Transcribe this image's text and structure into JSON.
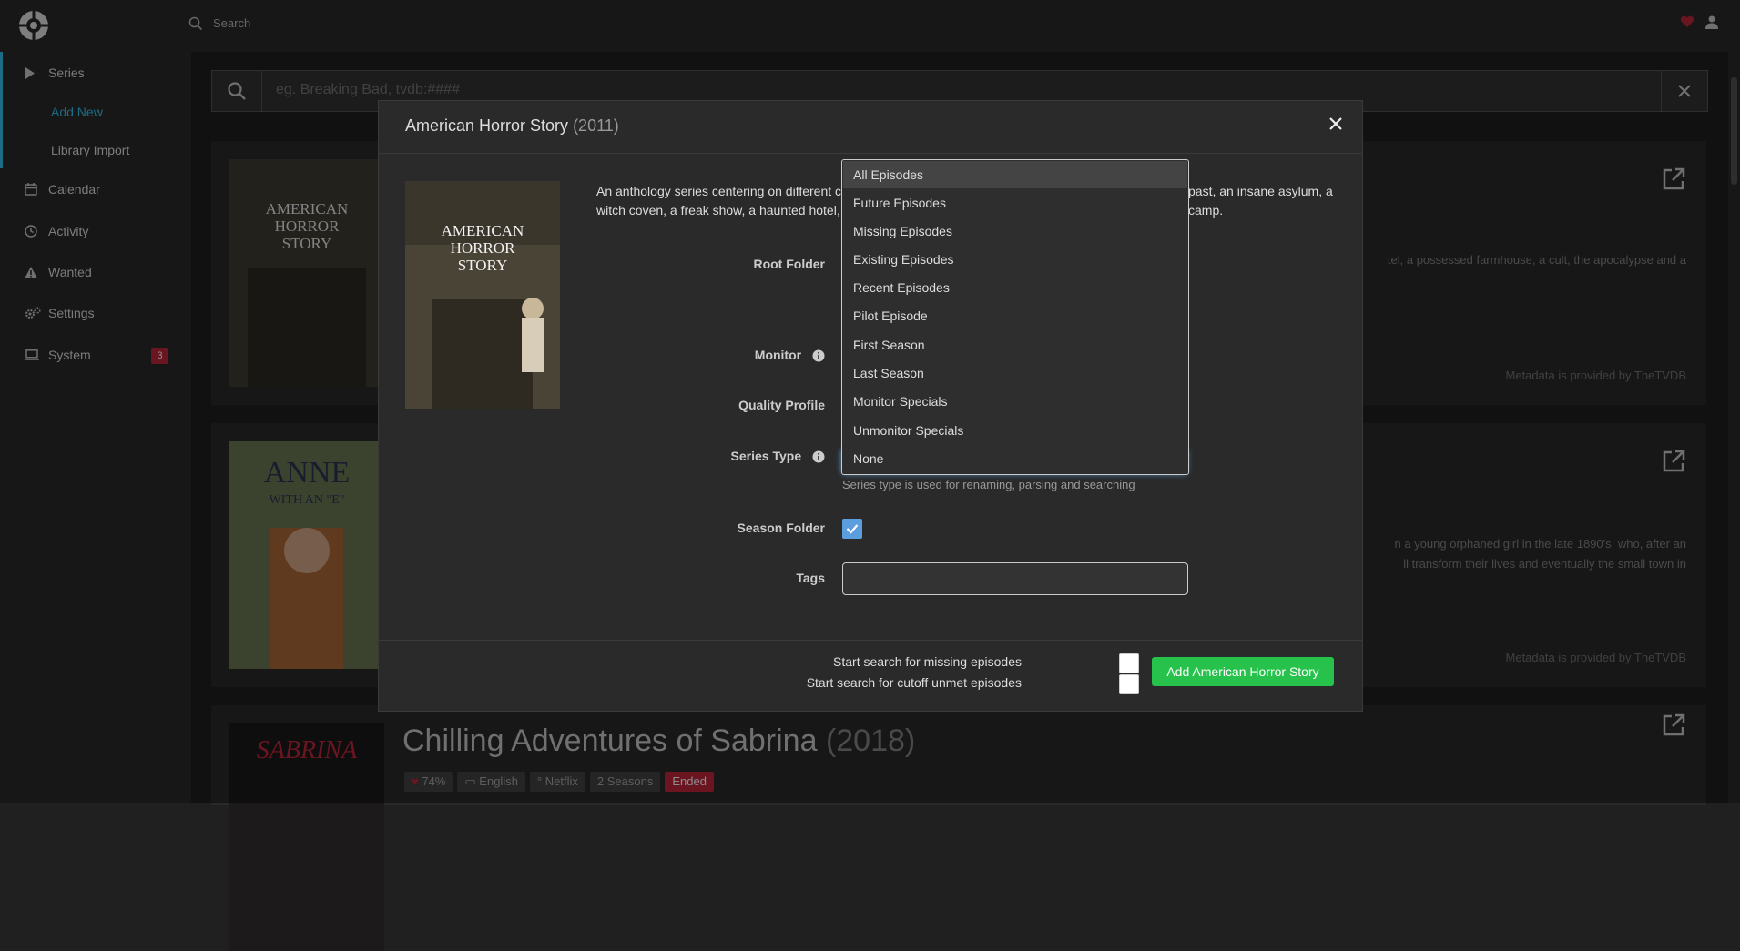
{
  "topbar": {
    "search_placeholder": "Search"
  },
  "sidebar": {
    "items": [
      {
        "label": "Series"
      },
      {
        "label": "Calendar"
      },
      {
        "label": "Activity"
      },
      {
        "label": "Wanted"
      },
      {
        "label": "Settings"
      },
      {
        "label": "System"
      }
    ],
    "sub_items": [
      {
        "label": "Add New"
      },
      {
        "label": "Library Import"
      }
    ],
    "system_badge": "3"
  },
  "main": {
    "search_placeholder": "eg. Breaking Bad, tvdb:####",
    "results": [
      {
        "desc_line1": "tel, a possessed farmhouse, a cult, the apocalypse and a",
        "metadata": "Metadata is provided by TheTVDB"
      },
      {
        "desc_line1": "n a young orphaned girl in the late 1890's, who, after an",
        "desc_line2": "ll transform their lives and eventually the small town in",
        "metadata": "Metadata is provided by TheTVDB"
      },
      {
        "title": "Chilling Adventures of Sabrina",
        "year": "(2018)",
        "rating": "74%",
        "language": "English",
        "network": "Netflix",
        "seasons": "2 Seasons",
        "status": "Ended"
      }
    ]
  },
  "modal": {
    "title": "American Horror Story",
    "year": "(2011)",
    "description_line1_a": "An anthology series centering on different c",
    "description_line1_b": "past, an insane asylum, a",
    "description_line2_a": "witch coven, a freak show, a haunted hotel, a",
    "description_line2_b": "camp.",
    "labels": {
      "root_folder": "Root Folder",
      "monitor": "Monitor",
      "quality_profile": "Quality Profile",
      "series_type": "Series Type",
      "season_folder": "Season Folder",
      "tags": "Tags"
    },
    "series_type_hint": "Series type is used for renaming, parsing and searching",
    "season_folder_checked": true,
    "footer": {
      "search_missing": "Start search for missing episodes",
      "search_cutoff": "Start search for cutoff unmet episodes",
      "add_button": "Add American Horror Story"
    }
  },
  "monitor_dropdown": {
    "selected": "All Episodes",
    "options": [
      "All Episodes",
      "Future Episodes",
      "Missing Episodes",
      "Existing Episodes",
      "Recent Episodes",
      "Pilot Episode",
      "First Season",
      "Last Season",
      "Monitor Specials",
      "Unmonitor Specials",
      "None"
    ]
  },
  "colors": {
    "accent": "#35c5f4",
    "add_button": "#27c24c",
    "badge": "#c4273c",
    "checkbox": "#5b9ee0"
  }
}
